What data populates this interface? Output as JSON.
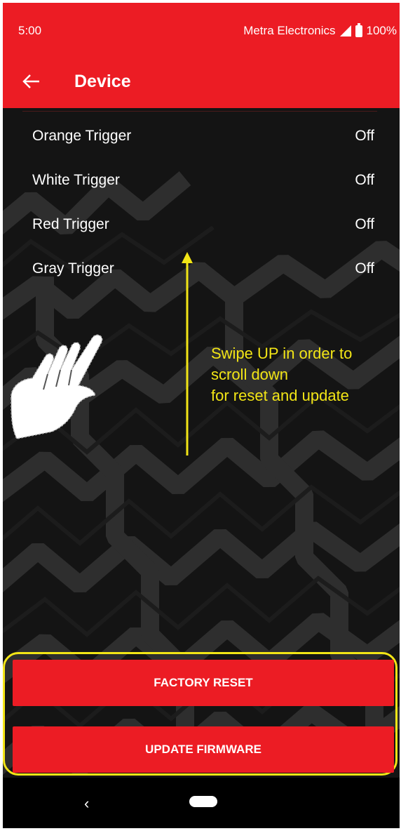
{
  "status_bar": {
    "time": "5:00",
    "carrier": "Metra Electronics",
    "battery": "100%"
  },
  "app_bar": {
    "title": "Device"
  },
  "triggers": [
    {
      "label": "Orange Trigger",
      "value": "Off"
    },
    {
      "label": "White Trigger",
      "value": "Off"
    },
    {
      "label": "Red Trigger",
      "value": "Off"
    },
    {
      "label": "Gray Trigger",
      "value": "Off"
    }
  ],
  "hint": {
    "line1": "Swipe UP in order to",
    "line2": "scroll down",
    "line3": "for reset and update"
  },
  "buttons": {
    "factory_reset": "FACTORY RESET",
    "update_firmware": "UPDATE FIRMWARE"
  },
  "colors": {
    "brand_red": "#ec1c24",
    "annotation_yellow": "#f2e516"
  }
}
